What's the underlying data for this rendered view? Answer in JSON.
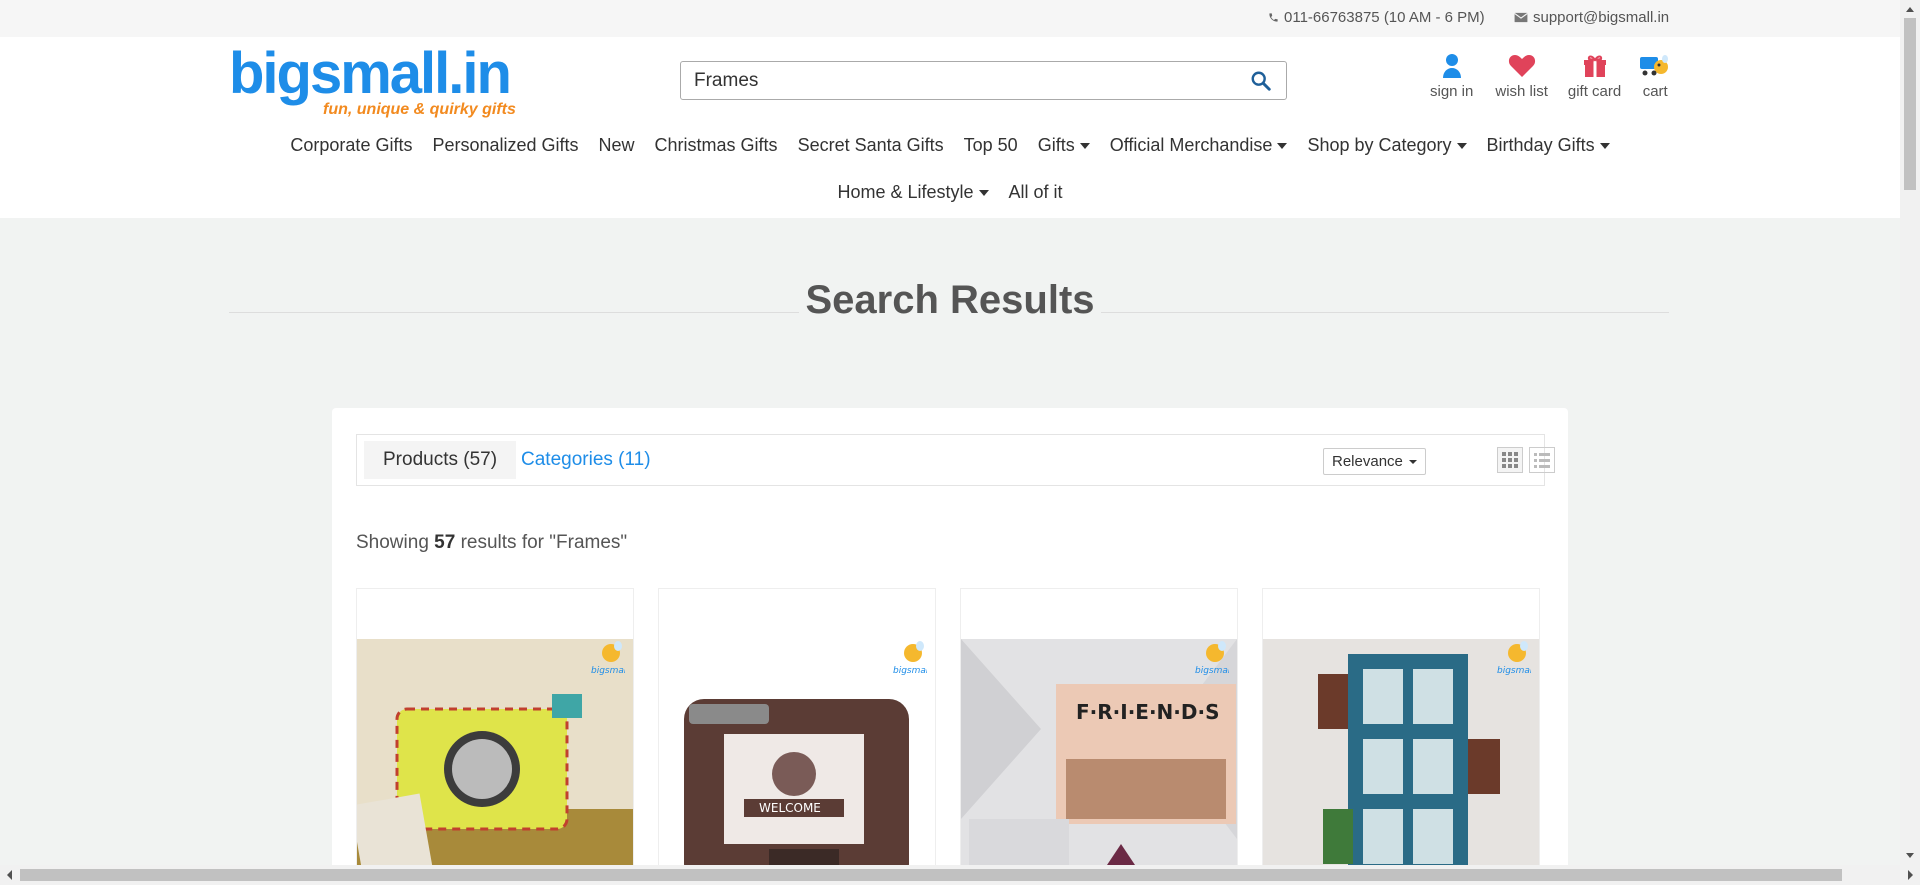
{
  "topbar": {
    "phone": "011-66763875 (10 AM - 6 PM)",
    "email": "support@bigsmall.in"
  },
  "logo": {
    "name": "bigsmall.in",
    "tagline": "fun, unique & quirky gifts"
  },
  "search": {
    "value": "Frames"
  },
  "header_icons": {
    "sign_in": "sign in",
    "wish_list": "wish list",
    "gift_card": "gift card",
    "cart": "cart"
  },
  "nav": {
    "row1": [
      "Corporate Gifts",
      "Personalized Gifts",
      "New",
      "Christmas Gifts",
      "Secret Santa Gifts",
      "Top 50",
      "Gifts",
      "Official Merchandise",
      "Shop by Category",
      "Birthday Gifts"
    ],
    "row2": [
      "Home & Lifestyle",
      "All of it"
    ]
  },
  "main": {
    "title": "Search Results",
    "tab_products": "Products (57)",
    "tab_categories": "Categories (11)",
    "sort_label": "Relevance",
    "showing_prefix": "Showing",
    "showing_count": "57",
    "showing_suffix": "results for \"Frames\""
  },
  "colors": {
    "brand_blue": "#1e8de8",
    "brand_orange": "#f28a1f"
  }
}
